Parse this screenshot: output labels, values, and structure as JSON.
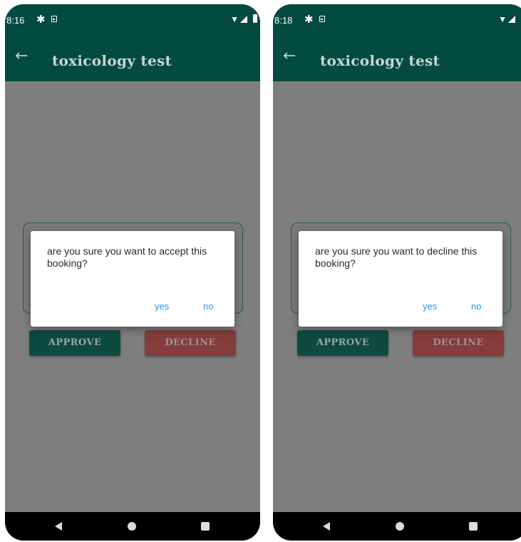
{
  "screens": [
    {
      "status_time": "8:16",
      "appbar_title": "toxicology test",
      "buttons": {
        "approve": "APPROVE",
        "decline": "DECLINE"
      },
      "dialog": {
        "message": "are you sure you want to accept this booking?",
        "yes": "yes",
        "no": "no"
      }
    },
    {
      "status_time": "8:18",
      "appbar_title": "toxicology test",
      "buttons": {
        "approve": "APPROVE",
        "decline": "DECLINE"
      },
      "dialog": {
        "message": "are you sure you want to decline this booking?",
        "yes": "yes",
        "no": "no"
      }
    }
  ],
  "icons": {
    "status": [
      "gear-icon",
      "sim-icon",
      "wifi-icon",
      "signal-icon",
      "battery-icon"
    ],
    "appbar": "back-arrow-icon",
    "navbar": [
      "nav-back-icon",
      "nav-home-icon",
      "nav-recents-icon"
    ]
  },
  "colors": {
    "appbar": "#034a41",
    "scrim": "#7e7e7e",
    "approve_button": "#0d4a42",
    "decline_button": "#843c3c",
    "dialog_action": "#2196f3"
  }
}
